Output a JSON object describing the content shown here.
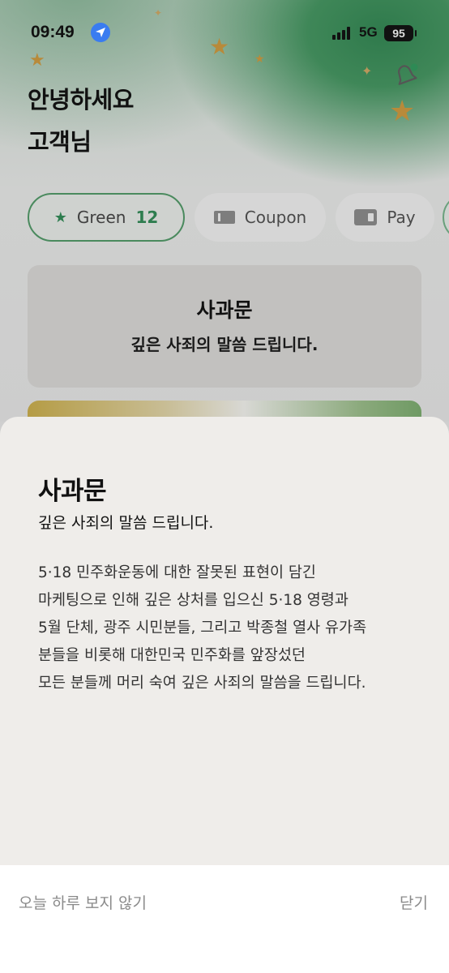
{
  "status_bar": {
    "time": "09:49",
    "network": "5G",
    "battery": "95"
  },
  "greeting": {
    "line1": "안녕하세요",
    "line2": "고객님"
  },
  "chips": {
    "green": {
      "label": "Green",
      "count": "12"
    },
    "coupon": {
      "label": "Coupon"
    },
    "pay": {
      "label": "Pay"
    }
  },
  "notice_card": {
    "title": "사과문",
    "subtitle": "깊은 사죄의 말씀 드립니다."
  },
  "sheet": {
    "title": "사과문",
    "subtitle": "깊은 사죄의 말씀 드립니다.",
    "body_lines": [
      "5·18 민주화운동에 대한 잘못된 표현이 담긴",
      "마케팅으로 인해 깊은 상처를 입으신 5·18 영령과",
      "5월 단체, 광주 시민분들, 그리고 박종철 열사 유가족",
      "분들을 비롯해 대한민국 민주화를 앞장섰던",
      "모든 분들께 머리 숙여 깊은 사죄의 말씀을 드립니다."
    ]
  },
  "footer": {
    "hide_today": "오늘 하루 보지 않기",
    "close": "닫기"
  },
  "colors": {
    "accent_green": "#2e7d4f",
    "sheet_bg": "#efedea",
    "location_blue": "#3a7cf0"
  }
}
